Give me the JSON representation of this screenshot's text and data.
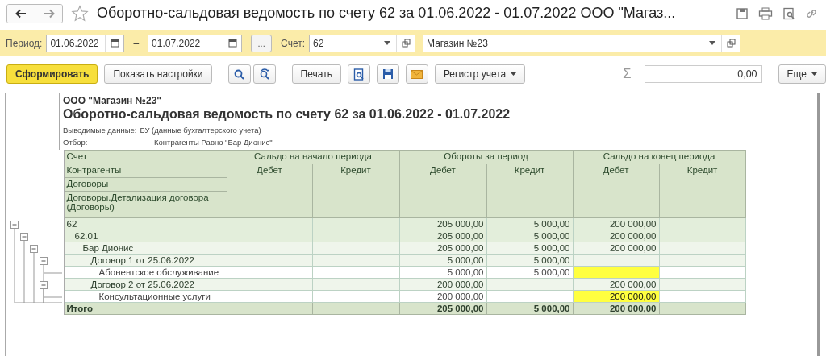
{
  "window": {
    "title": "Оборотно-сальдовая ведомость по счету 62 за 01.06.2022 - 01.07.2022 ООО \"Магаз..."
  },
  "filters": {
    "period_label": "Период:",
    "date_from": "01.06.2022",
    "dash": "–",
    "date_to": "01.07.2022",
    "more_button": "...",
    "account_label": "Счет:",
    "account": "62",
    "organization": "Магазин №23"
  },
  "toolbar": {
    "generate": "Сформировать",
    "settings": "Показать настройки",
    "print": "Печать",
    "register": "Регистр учета",
    "sum_sign": "Σ",
    "sum_value": "0,00",
    "more": "Еще"
  },
  "report": {
    "organization": "ООО \"Магазин №23\"",
    "title": "Оборотно-сальдовая ведомость по счету 62 за 01.06.2022 - 01.07.2022",
    "output_label": "Выводимые данные:",
    "output_value": "БУ (данные бухгалтерского учета)",
    "filter_label": "Отбор:",
    "filter_value": "Контрагенты Равно \"Бар Дионис\"",
    "row_headers": [
      "Счет",
      "Контрагенты",
      "Договоры",
      "Договоры.Детализация договора (Договоры)"
    ],
    "groups": [
      {
        "title": "Сальдо на начало периода",
        "debit": "Дебет",
        "credit": "Кредит"
      },
      {
        "title": "Обороты за период",
        "debit": "Дебет",
        "credit": "Кредит"
      },
      {
        "title": "Сальдо на конец периода",
        "debit": "Дебет",
        "credit": "Кредит"
      }
    ],
    "rows": [
      {
        "name": "62",
        "turn_debit": "205 000,00",
        "turn_credit": "5 000,00",
        "close_debit": "200 000,00",
        "highlighted": false,
        "expanded": true,
        "children": [
          {
            "name": "62.01",
            "turn_debit": "205 000,00",
            "turn_credit": "5 000,00",
            "close_debit": "200 000,00",
            "highlighted": false,
            "expanded": true,
            "children": [
              {
                "name": "Бар Дионис",
                "turn_debit": "205 000,00",
                "turn_credit": "5 000,00",
                "close_debit": "200 000,00",
                "highlighted": false,
                "expanded": true,
                "children": [
                  {
                    "name": "Договор 1 от 25.06.2022",
                    "turn_debit": "5 000,00",
                    "turn_credit": "5 000,00",
                    "highlighted": false,
                    "expanded": true,
                    "children": [
                      {
                        "name": "Абонентское обслуживание",
                        "turn_debit": "5 000,00",
                        "turn_credit": "5 000,00",
                        "highlighted": true
                      }
                    ]
                  },
                  {
                    "name": "Договор 2 от 25.06.2022",
                    "turn_debit": "200 000,00",
                    "close_debit": "200 000,00",
                    "highlighted": false,
                    "expanded": true,
                    "children": [
                      {
                        "name": "Консультационные услуги",
                        "turn_debit": "200 000,00",
                        "close_debit": "200 000,00",
                        "highlighted": true
                      }
                    ]
                  }
                ]
              }
            ]
          }
        ]
      }
    ],
    "total": {
      "name": "Итого",
      "turn_debit": "205 000,00",
      "turn_credit": "5 000,00",
      "close_debit": "200 000,00"
    }
  }
}
